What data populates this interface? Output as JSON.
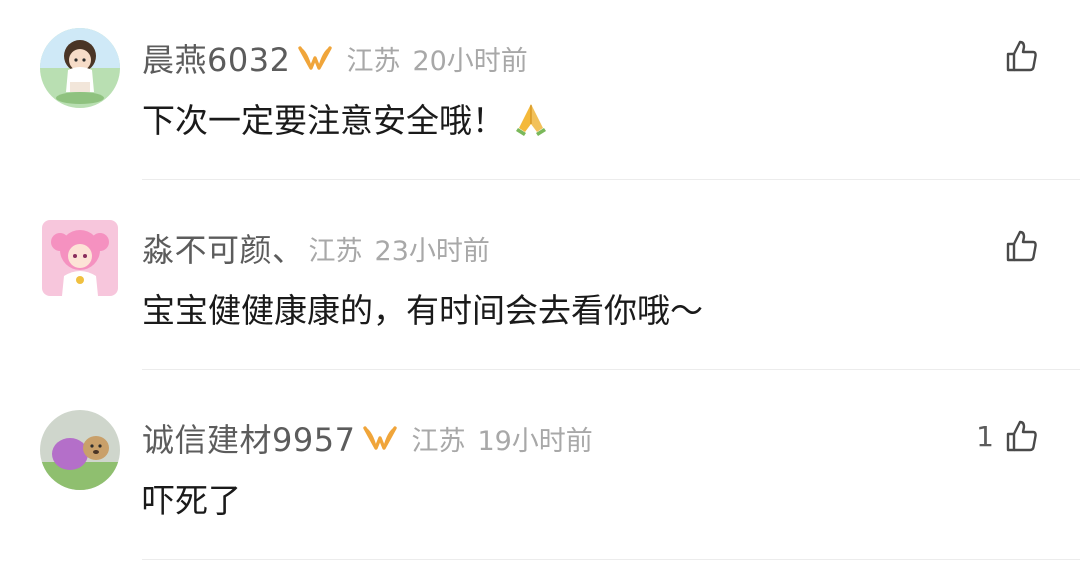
{
  "comments": [
    {
      "username": "晨燕6032",
      "has_vip_badge": true,
      "location": "江苏",
      "time": "20小时前",
      "content": "下次一定要注意安全哦！",
      "emoji": "folded-hands-icon",
      "like_count": "",
      "avatar": "cartoon-girl-avatar"
    },
    {
      "username": "淼不可颜、",
      "has_vip_badge": false,
      "location": "江苏",
      "time": "23小时前",
      "content": "宝宝健健康康的，有时间会去看你哦～",
      "like_count": "",
      "avatar": "anime-pink-hair-avatar"
    },
    {
      "username": "诚信建材9957",
      "has_vip_badge": true,
      "location": "江苏",
      "time": "19小时前",
      "content": "吓死了",
      "like_count": "1",
      "avatar": "dog-photo-avatar"
    }
  ],
  "colors": {
    "username": "#5c5c5c",
    "meta": "#a8a8a8",
    "content": "#1a1a1a",
    "vip_badge": "#f0a53a",
    "divider": "#ececec"
  }
}
